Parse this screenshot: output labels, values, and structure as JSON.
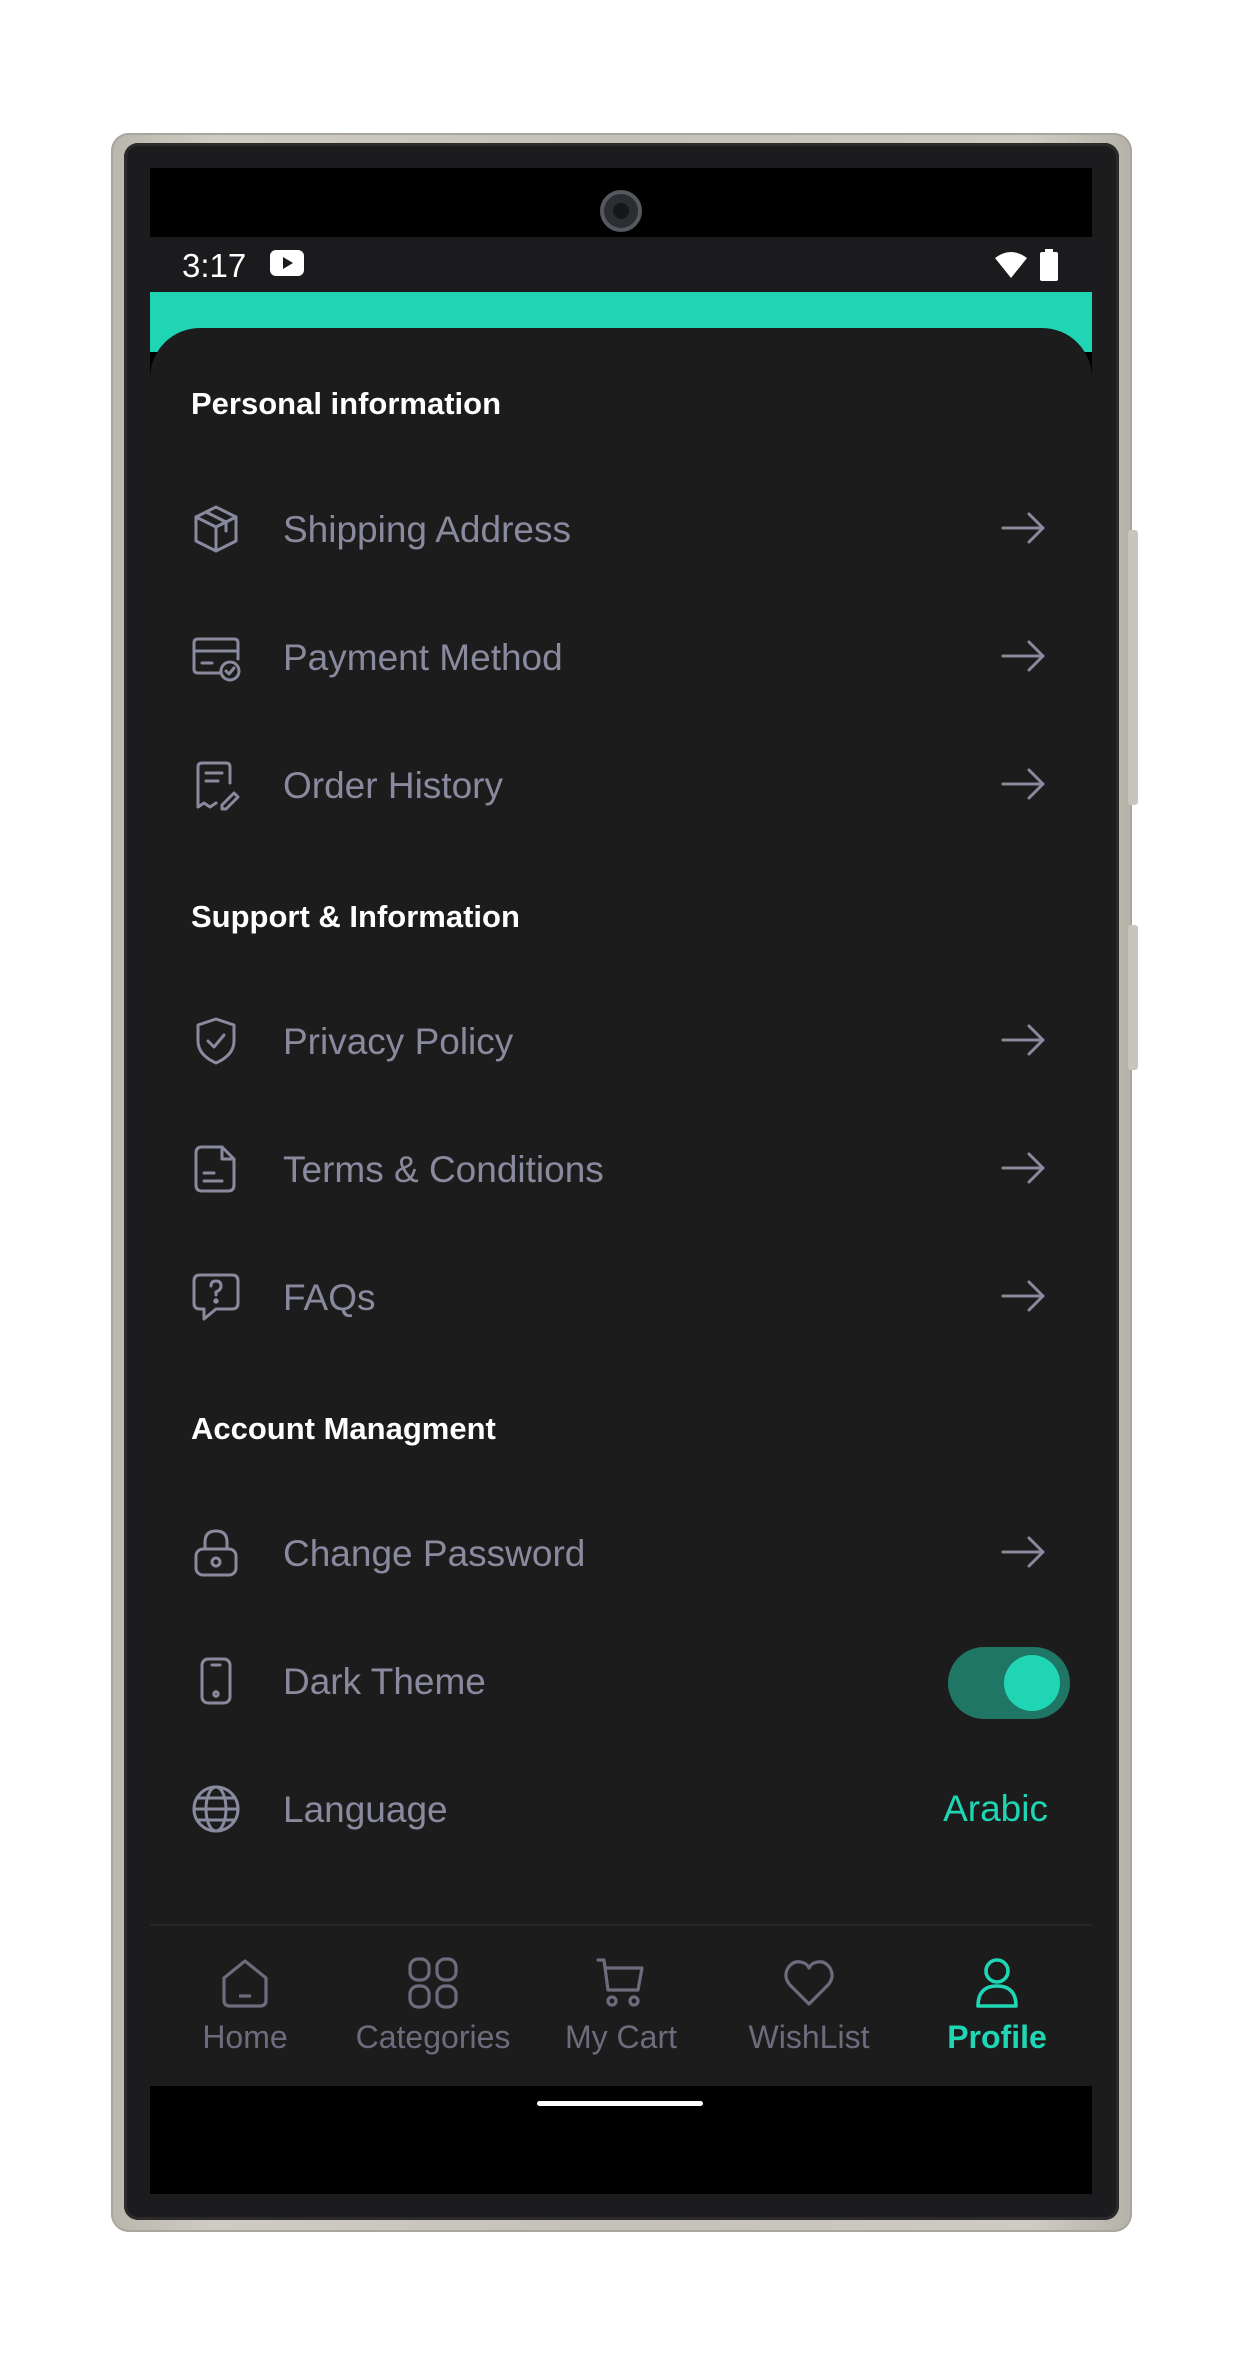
{
  "status_bar": {
    "time": "3:17",
    "icons": [
      "youtube-icon",
      "wifi-icon",
      "battery-icon"
    ]
  },
  "colors": {
    "accent": "#1fd5b4",
    "background": "#1c1c1d",
    "muted_text": "#8a8a9e",
    "toggle_track": "#1f7665"
  },
  "sections": {
    "personal": {
      "title": "Personal information",
      "items": [
        {
          "label": "Shipping Address",
          "icon": "package-icon"
        },
        {
          "label": "Payment Method",
          "icon": "card-check-icon"
        },
        {
          "label": "Order History",
          "icon": "receipt-edit-icon"
        }
      ]
    },
    "support": {
      "title": "Support & Information",
      "items": [
        {
          "label": "Privacy Policy",
          "icon": "shield-check-icon"
        },
        {
          "label": "Terms & Conditions",
          "icon": "document-icon"
        },
        {
          "label": "FAQs",
          "icon": "question-bubble-icon"
        }
      ]
    },
    "account": {
      "title": "Account Managment",
      "items": [
        {
          "label": "Change Password",
          "icon": "lock-icon"
        },
        {
          "label": "Dark Theme",
          "icon": "phone-icon",
          "toggle_on": true
        },
        {
          "label": "Language",
          "icon": "globe-icon",
          "value": "Arabic"
        }
      ]
    }
  },
  "bottom_nav": {
    "items": [
      {
        "label": "Home",
        "icon": "home-icon"
      },
      {
        "label": "Categories",
        "icon": "grid-icon"
      },
      {
        "label": "My Cart",
        "icon": "cart-icon"
      },
      {
        "label": "WishList",
        "icon": "heart-icon"
      },
      {
        "label": "Profile",
        "icon": "user-icon",
        "active": true
      }
    ]
  }
}
